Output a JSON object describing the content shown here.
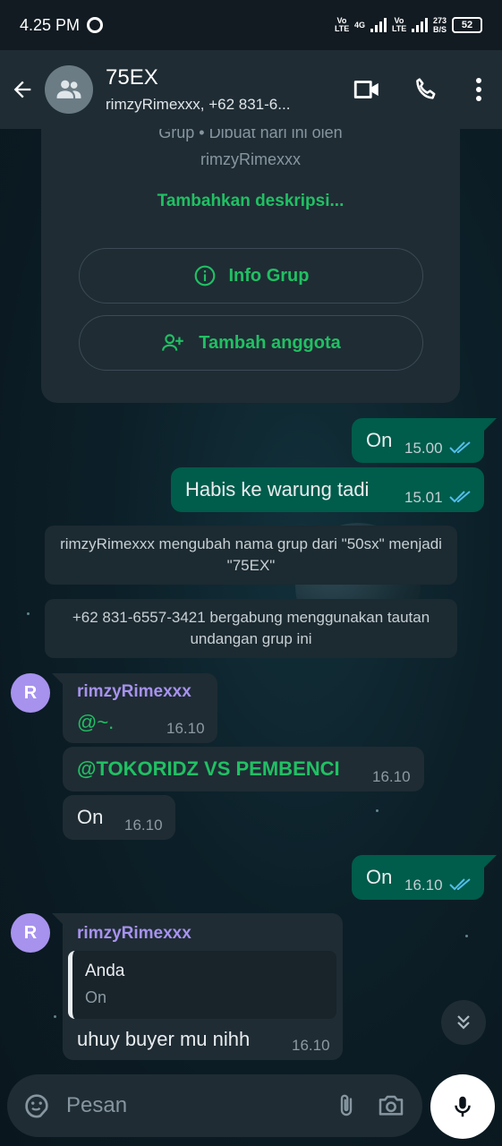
{
  "status_bar": {
    "time": "4.25 PM",
    "net_tag_1": "Vo LTE",
    "net_4g": "4G",
    "net_tag_2": "Vo LTE",
    "speed_value": "273",
    "speed_unit": "B/S",
    "battery": "52"
  },
  "header": {
    "title": "75EX",
    "subtitle": "rimzyRimexxx, +62 831-6..."
  },
  "group_info": {
    "meta_line_1": "Grup • Dibuat hari ini oleh",
    "meta_line_2": "rimzyRimexxx",
    "add_description": "Tambahkan deskripsi...",
    "info_button": "Info Grup",
    "add_member_button": "Tambah anggota"
  },
  "messages": [
    {
      "text": "On",
      "time": "15.00"
    },
    {
      "text": "Habis ke warung tadi",
      "time": "15.01"
    }
  ],
  "notices": [
    "rimzyRimexxx mengubah nama grup dari \"50sx\" menjadi \"75EX\"",
    "+62 831-6557-3421 bergabung menggunakan tautan undangan grup ini"
  ],
  "incoming": {
    "avatar_letter": "R",
    "sender": "rimzyRimexxx",
    "msg1_text": "@~.",
    "msg1_time": "16.10",
    "msg2_text": "@TOKORIDZ VS PEMBENCI",
    "msg2_time": "16.10",
    "msg3_text": "On",
    "msg3_time": "16.10"
  },
  "outgoing_2": {
    "text": "On",
    "time": "16.10"
  },
  "reply_msg": {
    "avatar_letter": "R",
    "sender": "rimzyRimexxx",
    "quote_name": "Anda",
    "quote_text": "On",
    "text": "uhuy buyer mu nihh",
    "time": "16.10"
  },
  "composer": {
    "placeholder": "Pesan"
  },
  "colors": {
    "accent": "#21c063",
    "outgoing_bubble": "#005c4b",
    "incoming_bubble": "#1f2c34",
    "sender_name": "#a792ee",
    "read_tick": "#53bdeb"
  }
}
